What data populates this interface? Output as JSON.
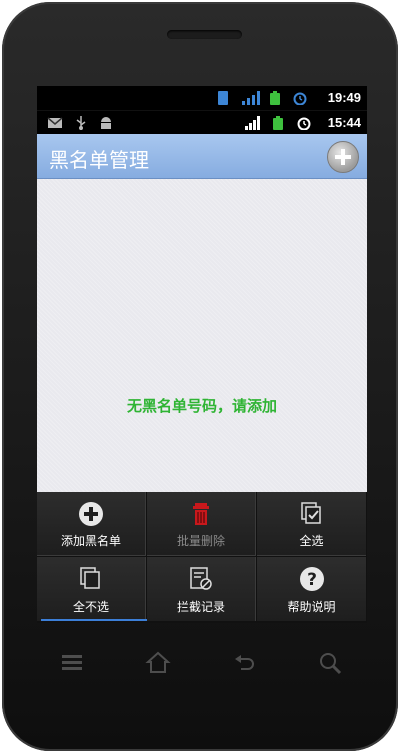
{
  "status_outer": {
    "time": "19:49",
    "icons": [
      "sim-icon",
      "signal-icon",
      "battery-icon",
      "alarm-icon"
    ]
  },
  "status_inner": {
    "time": "15:44",
    "icons_left": [
      "mail-icon",
      "usb-icon",
      "android-icon"
    ],
    "icons_right": [
      "signal-icon",
      "battery-icon",
      "alarm-icon"
    ]
  },
  "titlebar": {
    "title": "黑名单管理",
    "add_icon": "plus-circle-icon"
  },
  "content": {
    "empty_message": "无黑名单号码，请添加"
  },
  "menu": {
    "items": [
      {
        "label": "添加黑名单",
        "icon": "plus-circle-icon",
        "enabled": true
      },
      {
        "label": "批量删除",
        "icon": "trash-icon",
        "enabled": false
      },
      {
        "label": "全选",
        "icon": "select-all-icon",
        "enabled": true
      },
      {
        "label": "全不选",
        "icon": "deselect-all-icon",
        "enabled": true
      },
      {
        "label": "拦截记录",
        "icon": "block-log-icon",
        "enabled": true
      },
      {
        "label": "帮助说明",
        "icon": "help-icon",
        "enabled": true
      }
    ]
  },
  "colors": {
    "title_bar": "#98b9e8",
    "empty_text": "#2fb434",
    "menu_bg": "#1e1e1e",
    "menu_highlight": "#3c7fd8",
    "trash_red": "#c8181c"
  }
}
